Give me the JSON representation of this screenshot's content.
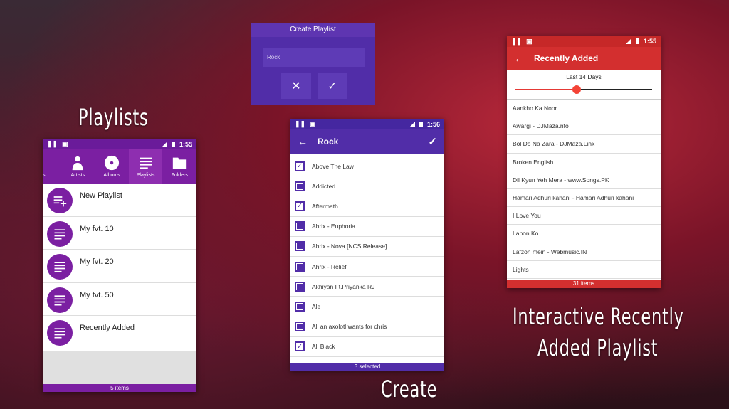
{
  "captions": {
    "playlists": "Playlists",
    "create": "Create",
    "interactive_line1": "Interactive Recently",
    "interactive_line2": "Added Playlist"
  },
  "colors": {
    "purple": "#7b1fa2",
    "deep_purple": "#512da8",
    "red": "#d32f2f"
  },
  "playlists_screen": {
    "time": "1:55",
    "tabs": [
      {
        "label": "s",
        "icon": "songs-icon"
      },
      {
        "label": "Artists",
        "icon": "artist-icon"
      },
      {
        "label": "Albums",
        "icon": "album-icon"
      },
      {
        "label": "Playlists",
        "icon": "playlist-icon",
        "selected": true
      },
      {
        "label": "Folders",
        "icon": "folder-icon"
      }
    ],
    "items": [
      {
        "label": "New Playlist",
        "icon": "playlist-add-icon"
      },
      {
        "label": "My fvt. 10",
        "icon": "playlist-icon"
      },
      {
        "label": "My fvt. 20",
        "icon": "playlist-icon"
      },
      {
        "label": "My fvt. 50",
        "icon": "playlist-icon"
      },
      {
        "label": "Recently Added",
        "icon": "playlist-icon"
      }
    ],
    "footer": "5 items"
  },
  "create_dialog": {
    "title": "Create Playlist",
    "input_value": "Rock",
    "cancel_icon": "close-icon",
    "confirm_icon": "check-icon"
  },
  "rock_screen": {
    "time": "1:56",
    "title": "Rock",
    "songs": [
      {
        "label": "Above The Law",
        "checked": true
      },
      {
        "label": "Addicted",
        "checked": false
      },
      {
        "label": "Aftermath",
        "checked": true
      },
      {
        "label": "Ahrix - Euphoria",
        "checked": false
      },
      {
        "label": "Ahrix - Nova [NCS Release]",
        "checked": false
      },
      {
        "label": "Ahrix - Relief",
        "checked": false
      },
      {
        "label": "Akhiyan Ft.Priyanka RJ",
        "checked": false
      },
      {
        "label": "Ale",
        "checked": false
      },
      {
        "label": "All an axolotl wants for chris",
        "checked": false
      },
      {
        "label": "All Black",
        "checked": true
      }
    ],
    "footer": "3 selected"
  },
  "recent_screen": {
    "time": "1:55",
    "title": "Recently Added",
    "slider_label": "Last 14 Days",
    "slider_fraction": 0.45,
    "songs": [
      "Aankho Ka Noor",
      "Awargi - DJMaza.nfo",
      "Bol Do Na Zara - DJMaza.Link",
      "Broken English",
      "Dil Kyun Yeh Mera - www.Songs.PK",
      "Hamari Adhuri kahani - Hamari Adhuri kahani",
      "I Love You",
      "Labon Ko",
      "Lafzon mein - Webmusic.IN",
      "Lights"
    ],
    "footer": "31 items"
  }
}
